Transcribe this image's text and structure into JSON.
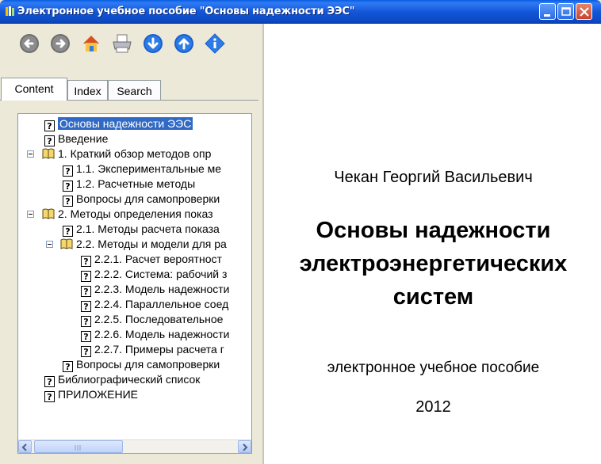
{
  "window": {
    "title": "Электронное учебное пособие \"Основы надежности ЭЭС\"",
    "colors": {
      "titlebar": "#0a5de0",
      "selection": "#316ac5"
    }
  },
  "toolbar": {
    "buttons": [
      "back-icon",
      "forward-icon",
      "home-icon",
      "print-icon",
      "down-icon",
      "up-icon",
      "info-icon"
    ]
  },
  "tabs": [
    "Content",
    "Index",
    "Search"
  ],
  "tree": {
    "items": [
      {
        "label": "Основы надежности ЭЭС",
        "type": "page",
        "selected": true
      },
      {
        "label": "Введение",
        "type": "page"
      },
      {
        "label": "1. Краткий обзор методов опр",
        "type": "book"
      },
      {
        "label": "1.1. Экспериментальные ме",
        "type": "page"
      },
      {
        "label": "1.2. Расчетные методы",
        "type": "page"
      },
      {
        "label": "Вопросы для самопроверки",
        "type": "page"
      },
      {
        "label": "2. Методы определения показ",
        "type": "book"
      },
      {
        "label": "2.1. Методы расчета показа",
        "type": "page"
      },
      {
        "label": "2.2. Методы и модели для ра",
        "type": "book"
      },
      {
        "label": "2.2.1. Расчет вероятност",
        "type": "page"
      },
      {
        "label": "2.2.2. Система: рабочий з",
        "type": "page"
      },
      {
        "label": "2.2.3. Модель надежности",
        "type": "page"
      },
      {
        "label": "2.2.4. Параллельное соед",
        "type": "page"
      },
      {
        "label": "2.2.5. Последовательное",
        "type": "page"
      },
      {
        "label": "2.2.6. Модель надежности",
        "type": "page"
      },
      {
        "label": "2.2.7. Примеры расчета г",
        "type": "page"
      },
      {
        "label": "Вопросы для самопроверки",
        "type": "page"
      },
      {
        "label": "Библиографический список",
        "type": "page"
      },
      {
        "label": "ПРИЛОЖЕНИЕ",
        "type": "page"
      }
    ]
  },
  "content": {
    "author": "Чекан Георгий Васильевич",
    "title_lines": [
      "Основы надежности",
      "электроэнергетических",
      "систем"
    ],
    "subtitle": "электронное учебное пособие",
    "year": "2012"
  }
}
